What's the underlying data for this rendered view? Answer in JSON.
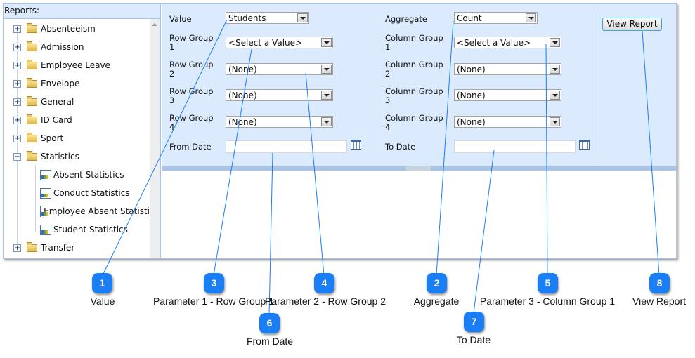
{
  "tree": {
    "header": "Reports:",
    "folders": [
      "Absenteeism",
      "Admission",
      "Employee Leave",
      "Envelope",
      "General",
      "ID Card",
      "Sport",
      "Statistics"
    ],
    "statistics_children": [
      "Absent Statistics",
      "Conduct Statistics",
      "Employee Absent Statisti",
      "Student Statistics"
    ],
    "last_folder": "Transfer"
  },
  "form": {
    "value_label": "Value",
    "value": "Students",
    "aggregate_label": "Aggregate",
    "aggregate": "Count",
    "row_groups": [
      {
        "label": "Row Group",
        "num": "1",
        "value": "<Select a Value>"
      },
      {
        "label": "Row Group",
        "num": "2",
        "value": "(None)"
      },
      {
        "label": "Row Group",
        "num": "3",
        "value": "(None)"
      },
      {
        "label": "Row Group",
        "num": "4",
        "value": "(None)"
      }
    ],
    "column_groups": [
      {
        "label": "Column Group",
        "num": "1",
        "value": "<Select a Value>"
      },
      {
        "label": "Column Group",
        "num": "2",
        "value": "(None)"
      },
      {
        "label": "Column Group",
        "num": "3",
        "value": "(None)"
      },
      {
        "label": "Column Group",
        "num": "4",
        "value": "(None)"
      }
    ],
    "from_date_label": "From Date",
    "from_date": "",
    "to_date_label": "To Date",
    "to_date": "",
    "view_report": "View Report"
  },
  "callouts": [
    {
      "num": "1",
      "label": "Value"
    },
    {
      "num": "3",
      "label": "Parameter 1 - Row Group 1"
    },
    {
      "num": "4",
      "label": "Parameter 2 - Row Group 2"
    },
    {
      "num": "2",
      "label": "Aggregate"
    },
    {
      "num": "5",
      "label": "Parameter 3 - Column Group 1"
    },
    {
      "num": "8",
      "label": "View Report"
    },
    {
      "num": "6",
      "label": "From Date"
    },
    {
      "num": "7",
      "label": "To Date"
    }
  ],
  "colors": {
    "callout": "#1a7ef7",
    "panel": "#dbeafc",
    "border": "#a9c4e6"
  }
}
